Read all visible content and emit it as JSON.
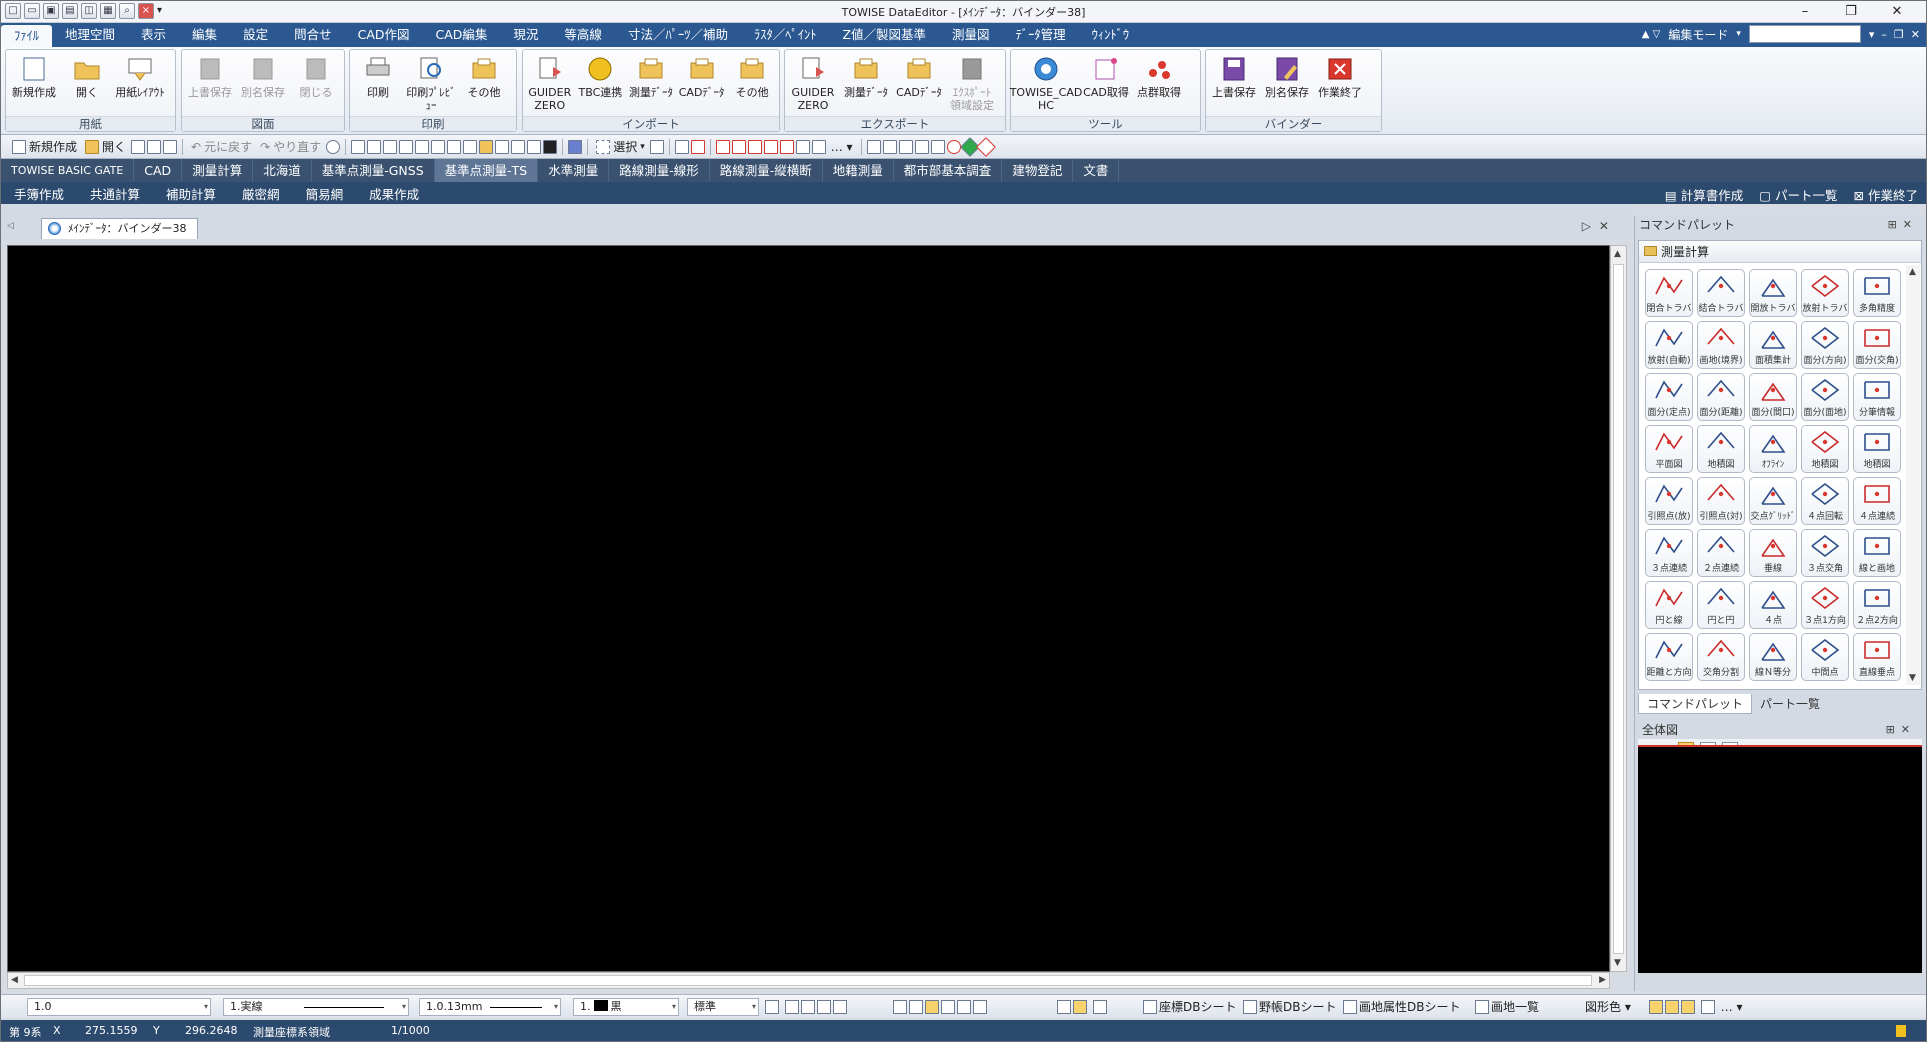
{
  "window": {
    "title": "TOWISE DataEditor - [ﾒｲﾝﾃﾞｰﾀ：バインダー38]",
    "qat_glyph": "▾",
    "controls": [
      "–",
      "❐",
      "✕"
    ]
  },
  "menubar": {
    "items": [
      "ﾌｧｲﾙ",
      "地理空間",
      "表示",
      "編集",
      "設定",
      "問合せ",
      "CAD作図",
      "CAD編集",
      "現況",
      "等高線",
      "寸法／ﾊﾟｰﾂ／補助",
      "ﾗｽﾀ／ﾍﾟｲﾝﾄ",
      "Z値／製図基準",
      "測量図",
      "ﾃﾞｰﾀ管理",
      "ｳｨﾝﾄﾞｳ"
    ],
    "mode_label": "編集モード",
    "arrows": "▲ ▽"
  },
  "ribbon": {
    "groups": [
      {
        "label": "用紙",
        "buttons": [
          "新規作成",
          "開く",
          "用紙ﾚｲｱｳﾄ"
        ]
      },
      {
        "label": "図面",
        "buttons": [
          "上書保存",
          "別名保存",
          "閉じる"
        ]
      },
      {
        "label": "印刷",
        "buttons": [
          "印刷",
          "印刷ﾌﾟﾚﾋﾞｭｰ",
          "その他"
        ]
      },
      {
        "label": "インポート",
        "buttons": [
          "GUIDER ZERO",
          "TBC連携",
          "測量ﾃﾞｰﾀ",
          "CADﾃﾞｰﾀ",
          "その他"
        ]
      },
      {
        "label": "エクスポート",
        "buttons": [
          "GUIDER ZERO",
          "測量ﾃﾞｰﾀ",
          "CADﾃﾞｰﾀ",
          "ｴｸｽﾎﾟｰﾄ 領域設定"
        ]
      },
      {
        "label": "ツール",
        "buttons": [
          "TOWISE_CAD HC",
          "CAD取得",
          "点群取得"
        ]
      },
      {
        "label": "バインダー",
        "buttons": [
          "上書保存",
          "別名保存",
          "作業終了"
        ]
      }
    ]
  },
  "toolbar": {
    "new": "新規作成",
    "open": "開く",
    "undo": "元に戻す",
    "redo": "やり直す",
    "select": "選択"
  },
  "gatetabs": [
    "TOWISE BASIC GATE",
    "CAD",
    "測量計算",
    "北海道",
    "基準点測量-GNSS",
    "基準点測量-TS",
    "水準測量",
    "路線測量-線形",
    "路線測量-縦横断",
    "地籍測量",
    "都市部基本調査",
    "建物登記",
    "文書"
  ],
  "subbar": {
    "items": [
      "手簿作成",
      "共通計算",
      "補助計算",
      "厳密網",
      "簡易網",
      "成果作成"
    ],
    "right": [
      "計算書作成",
      "パート一覧",
      "作業終了"
    ]
  },
  "document": {
    "tab_label": "ﾒｲﾝﾃﾞｰﾀ：バインダー38"
  },
  "command_palette": {
    "title": "コマンドパレット",
    "category": "測量計算",
    "buttons": [
      "閉合トラバ",
      "結合トラバ",
      "開放トラバ",
      "放射トラバ",
      "多角精度",
      "放射(自動)",
      "画地(境界)",
      "面積集計",
      "面分(方向)",
      "面分(交角)",
      "面分(定点)",
      "面分(距離)",
      "面分(間口)",
      "面分(面地)",
      "分筆情報",
      "平面図",
      "地積図",
      "ｵﾌﾗｲﾝ",
      "地積図",
      "地積図",
      "引照点(放)",
      "引照点(対)",
      "交点ｸﾞﾘｯﾄﾞ",
      "４点回転",
      "４点連続",
      "３点連続",
      "２点連続",
      "垂線",
      "３点交角",
      "線と画地",
      "円と線",
      "円と円",
      "４点",
      "３点1方向",
      "２点2方向",
      "距離と方向",
      "交角分割",
      "線Ｎ等分",
      "中間点",
      "直線垂点"
    ],
    "tabs": [
      "コマンドパレット",
      "パート一覧"
    ]
  },
  "overview": {
    "title": "全体図",
    "pages": [
      "1",
      "2",
      "3"
    ]
  },
  "bottom_toolbar": {
    "scale": "1.0",
    "linetype": "1.実線",
    "linewidth": "1.0.13mm",
    "color": "1.",
    "color_name": "黒",
    "style": "標準",
    "sheets": [
      "座標DBシート",
      "野帳DBシート",
      "画地属性DBシート",
      "画地一覧"
    ],
    "shape_color": "図形色"
  },
  "status": {
    "system": "第 9系",
    "x_label": "X",
    "x": "275.1559",
    "y_label": "Y",
    "y": "296.2648",
    "region": "測量座標系領域",
    "scale": "1/1000"
  }
}
